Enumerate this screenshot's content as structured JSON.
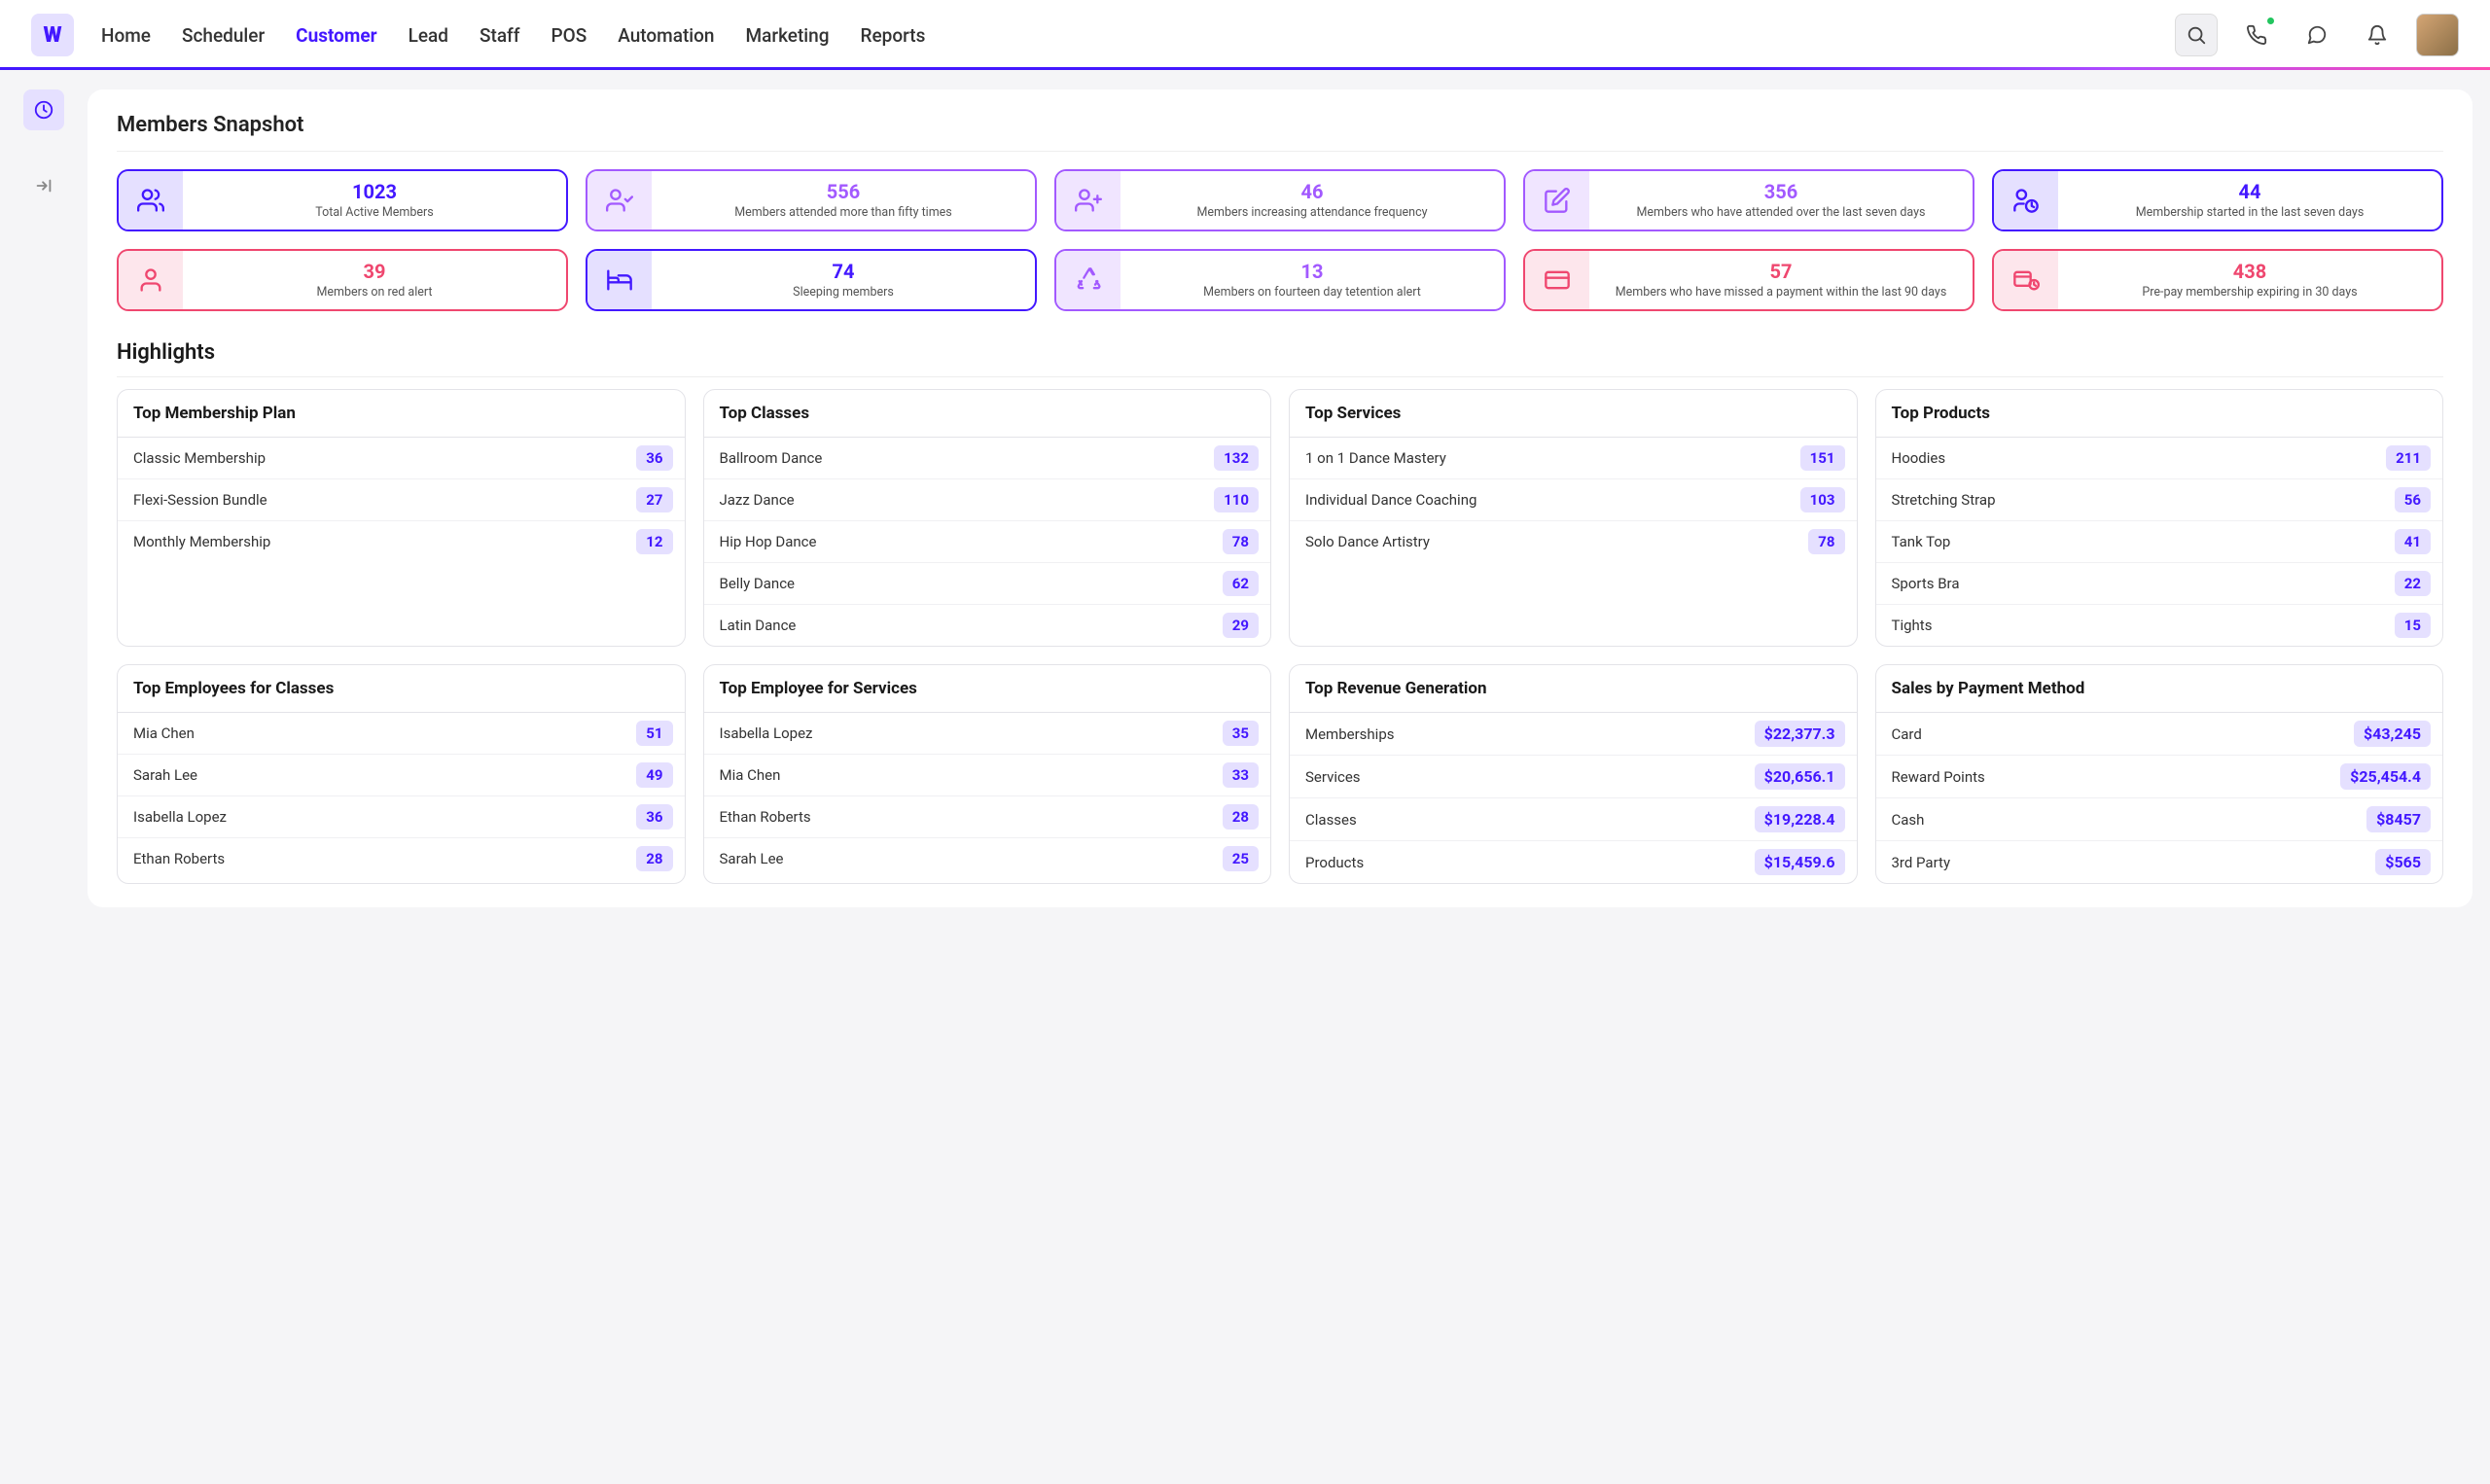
{
  "nav": {
    "items": [
      "Home",
      "Scheduler",
      "Customer",
      "Lead",
      "Staff",
      "POS",
      "Automation",
      "Marketing",
      "Reports"
    ],
    "active": "Customer"
  },
  "sections": {
    "snapshot_title": "Members Snapshot",
    "highlights_title": "Highlights"
  },
  "snapshot": [
    {
      "icon": "users",
      "theme": "blue",
      "value": "1023",
      "label": "Total Active Members"
    },
    {
      "icon": "user-check",
      "theme": "violet",
      "value": "556",
      "label": "Members attended more than fifty times"
    },
    {
      "icon": "user-plus",
      "theme": "violet",
      "value": "46",
      "label": "Members increasing attendance frequency"
    },
    {
      "icon": "edit",
      "theme": "violet",
      "value": "356",
      "label": "Members who have attended over the last seven days"
    },
    {
      "icon": "user-clock",
      "theme": "blue",
      "value": "44",
      "label": "Membership started in the last seven days"
    },
    {
      "icon": "user",
      "theme": "red",
      "value": "39",
      "label": "Members on red alert"
    },
    {
      "icon": "bed",
      "theme": "blue",
      "value": "74",
      "label": "Sleeping members"
    },
    {
      "icon": "recycle",
      "theme": "violet",
      "value": "13",
      "label": "Members on fourteen day tetention alert"
    },
    {
      "icon": "card",
      "theme": "red",
      "value": "57",
      "label": "Members who have missed a payment within the last 90 days"
    },
    {
      "icon": "card-clock",
      "theme": "red",
      "value": "438",
      "label": "Pre-pay membership expiring in 30 days"
    }
  ],
  "highlights": [
    {
      "title": "Top Membership Plan",
      "rows": [
        {
          "name": "Classic Membership",
          "value": "36"
        },
        {
          "name": "Flexi-Session Bundle",
          "value": "27"
        },
        {
          "name": "Monthly Membership",
          "value": "12"
        }
      ]
    },
    {
      "title": "Top Classes",
      "rows": [
        {
          "name": "Ballroom Dance",
          "value": "132"
        },
        {
          "name": "Jazz Dance",
          "value": "110"
        },
        {
          "name": "Hip Hop Dance",
          "value": "78"
        },
        {
          "name": "Belly Dance",
          "value": "62"
        },
        {
          "name": "Latin Dance",
          "value": "29"
        }
      ]
    },
    {
      "title": "Top Services",
      "rows": [
        {
          "name": "1 on 1 Dance Mastery",
          "value": "151"
        },
        {
          "name": "Individual Dance Coaching",
          "value": "103"
        },
        {
          "name": "Solo Dance Artistry",
          "value": "78"
        }
      ]
    },
    {
      "title": "Top Products",
      "rows": [
        {
          "name": "Hoodies",
          "value": "211"
        },
        {
          "name": "Stretching Strap",
          "value": "56"
        },
        {
          "name": "Tank Top",
          "value": "41"
        },
        {
          "name": "Sports Bra",
          "value": "22"
        },
        {
          "name": "Tights",
          "value": "15"
        }
      ]
    },
    {
      "title": "Top Employees for Classes",
      "rows": [
        {
          "name": "Mia Chen",
          "value": "51"
        },
        {
          "name": "Sarah Lee",
          "value": "49"
        },
        {
          "name": "Isabella Lopez",
          "value": "36"
        },
        {
          "name": "Ethan Roberts",
          "value": "28"
        }
      ]
    },
    {
      "title": "Top Employee for Services",
      "rows": [
        {
          "name": "Isabella Lopez",
          "value": "35"
        },
        {
          "name": "Mia Chen",
          "value": "33"
        },
        {
          "name": "Ethan Roberts",
          "value": "28"
        },
        {
          "name": "Sarah Lee",
          "value": "25"
        }
      ]
    },
    {
      "title": "Top Revenue Generation",
      "money": true,
      "rows": [
        {
          "name": "Memberships",
          "value": "$22,377.3"
        },
        {
          "name": "Services",
          "value": "$20,656.1"
        },
        {
          "name": "Classes",
          "value": "$19,228.4"
        },
        {
          "name": "Products",
          "value": "$15,459.6"
        }
      ]
    },
    {
      "title": "Sales by Payment Method",
      "money": true,
      "rows": [
        {
          "name": "Card",
          "value": "$43,245"
        },
        {
          "name": "Reward Points",
          "value": "$25,454.4"
        },
        {
          "name": "Cash",
          "value": "$8457"
        },
        {
          "name": "3rd Party",
          "value": "$565"
        }
      ]
    }
  ]
}
